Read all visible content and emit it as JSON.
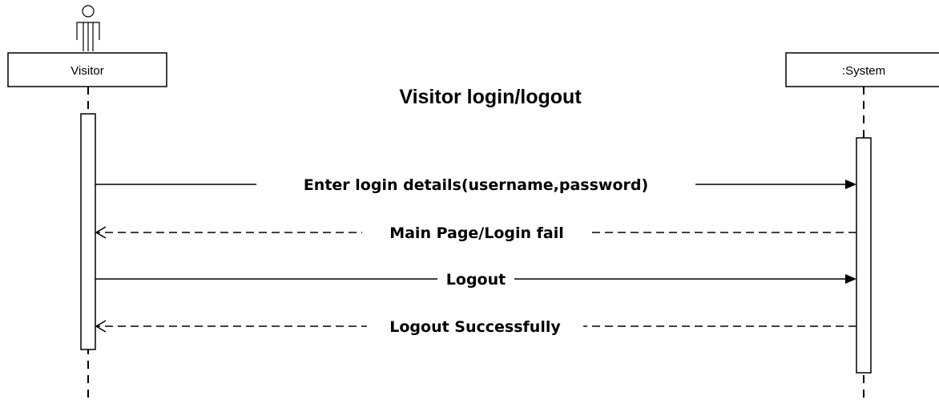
{
  "title": "Visitor login/logout",
  "participants": [
    {
      "id": "visitor",
      "label": "Visitor"
    },
    {
      "id": "system",
      "label": ":System"
    }
  ],
  "messages": [
    {
      "label": "Enter login details(username,password)",
      "from": "visitor",
      "to": "system",
      "style": "solid"
    },
    {
      "label": "Main Page/Login fail",
      "from": "system",
      "to": "visitor",
      "style": "dashed"
    },
    {
      "label": "Logout",
      "from": "visitor",
      "to": "system",
      "style": "solid"
    },
    {
      "label": "Logout Successfully",
      "from": "system",
      "to": "visitor",
      "style": "dashed"
    }
  ]
}
